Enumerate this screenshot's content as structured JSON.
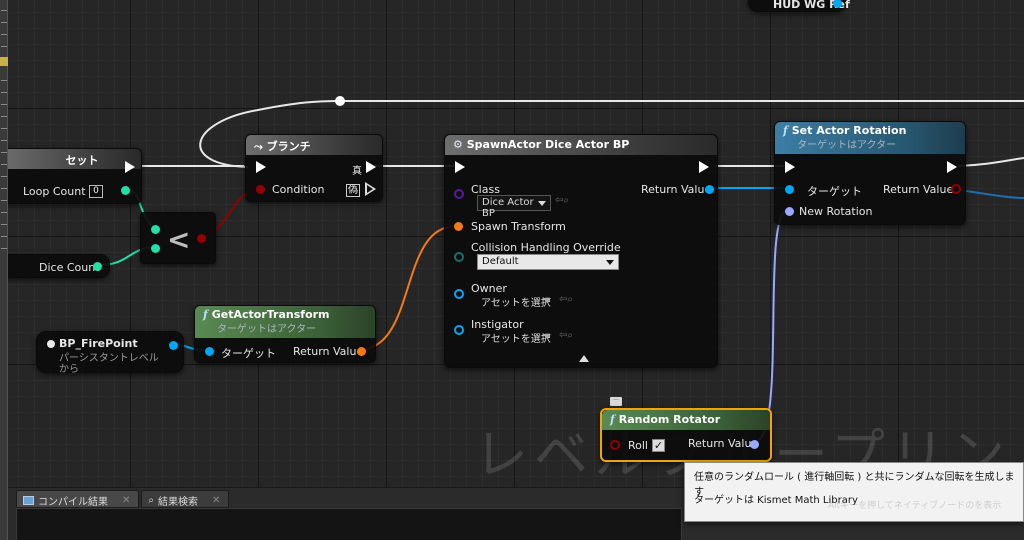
{
  "watermark": "レベルブループリント",
  "nodes": {
    "hud_ref": {
      "label": "HUD WG Ref"
    },
    "set_loop": {
      "title": "セット",
      "pin_label": "Loop Count",
      "pin_value": "0"
    },
    "dice_count": {
      "label": "Dice Count"
    },
    "less_than": {
      "symbol": "<"
    },
    "branch": {
      "title": "ブランチ",
      "condition_label": "Condition",
      "true_label": "真",
      "false_label": "偽"
    },
    "spawn_actor": {
      "title": "SpawnActor Dice Actor BP",
      "class_label": "Class",
      "class_value": "Dice Actor BP",
      "return_label": "Return Value",
      "spawn_transform_label": "Spawn Transform",
      "collision_label": "Collision Handling Override",
      "collision_value": "Default",
      "owner_label": "Owner",
      "owner_value": "アセットを選択",
      "instigator_label": "Instigator",
      "instigator_value": "アセットを選択"
    },
    "set_rotation": {
      "title": "Set Actor Rotation",
      "subtitle": "ターゲットはアクター",
      "target_label": "ターゲット",
      "return_label": "Return Value",
      "new_rotation_label": "New Rotation"
    },
    "get_transform": {
      "title": "GetActorTransform",
      "subtitle": "ターゲットはアクター",
      "target_label": "ターゲット",
      "return_label": "Return Value"
    },
    "firepoint": {
      "title": "BP_FirePoint",
      "subtitle_line1": "パーシスタントレベル",
      "subtitle_line2": "から"
    },
    "random_rotator": {
      "title": "Random Rotator",
      "roll_label": "Roll",
      "return_label": "Return Value",
      "roll_checked": true
    }
  },
  "bottom_tabs": [
    {
      "label": "コンパイル結果",
      "icon": "compile-results-icon"
    },
    {
      "label": "結果検索",
      "icon": "find-results-icon"
    }
  ],
  "tooltip": {
    "line1": "任意のランダムロール ( 進行軸回転 ) と共にランダムな回転を生成します",
    "line2": "ターゲットは Kismet Math Library"
  },
  "hint": "Altキーを押してネイティブノードのを表示",
  "colors": {
    "exec": "#ffffff",
    "object_pin": "#00a8f4",
    "class_pin": "#5a1a9a",
    "transform_pin": "#f37a16",
    "bool_pin": "#920101",
    "int_pin": "#1fe1a5",
    "rotator_pin": "#9aa8ff",
    "selection_outline": "#f0a30a"
  }
}
